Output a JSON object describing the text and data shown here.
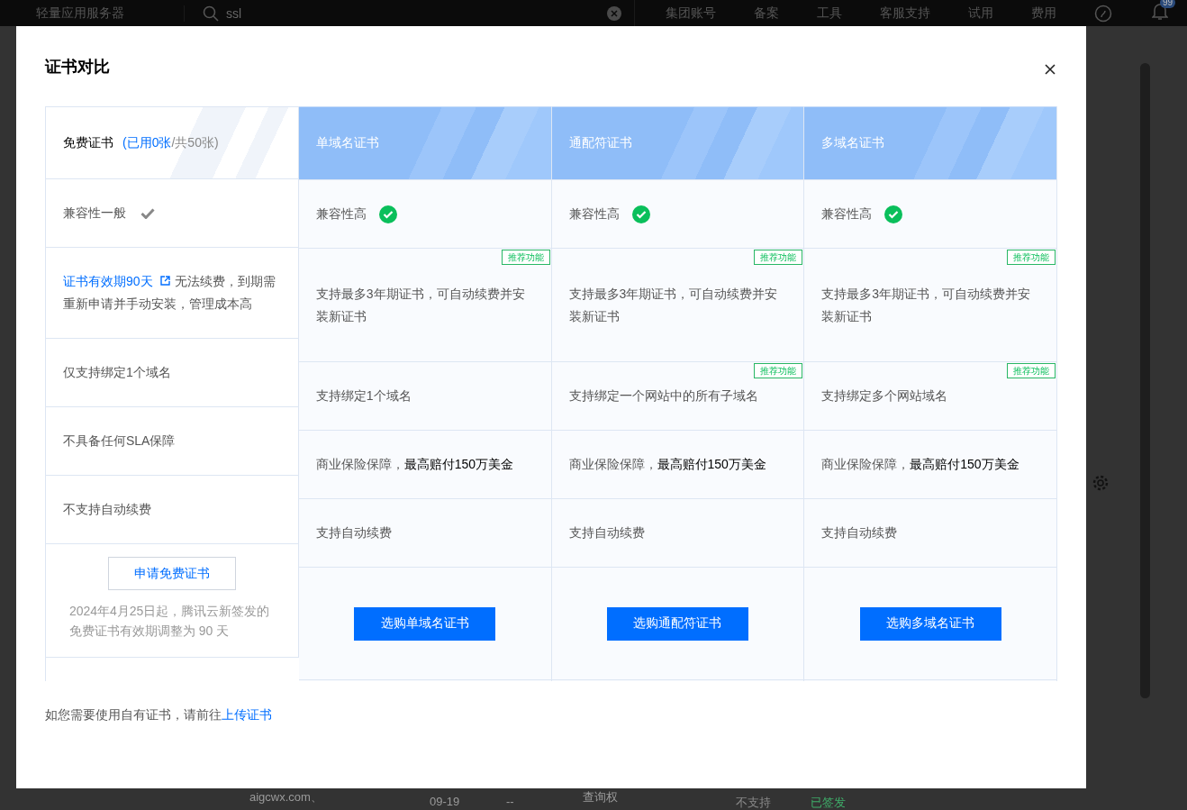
{
  "top_bar": {
    "product": "轻量应用服务器",
    "search": {
      "value": "ssl"
    },
    "nav": [
      "集团账号",
      "备案",
      "工具",
      "客服支持",
      "试用",
      "费用"
    ],
    "badge": "99"
  },
  "background_row": [
    "aigcwx.com、",
    "09-19",
    "--",
    "查询权",
    "不支持",
    "已签发"
  ],
  "dialog": {
    "title": "证书对比",
    "free": {
      "title": "免费证书",
      "used": "(已用0张",
      "total": "/共50张)",
      "rows": [
        {
          "kind": "compat-basic",
          "text": "兼容性一般"
        },
        {
          "kind": "link",
          "link": "证书有效期90天",
          "text": "无法续费，到期需重新申请并手动安装，管理成本高"
        },
        {
          "kind": "plain",
          "text": "仅支持绑定1个域名"
        },
        {
          "kind": "plain",
          "text": "不具备任何SLA保障"
        },
        {
          "kind": "plain",
          "text": "不支持自动续费"
        }
      ],
      "apply_button": "申请免费证书",
      "notice": "2024年4月25日起，腾讯云新签发的免费证书有效期调整为 90 天"
    },
    "plans": [
      {
        "name": "单域名证书",
        "buy_button": "选购单域名证书",
        "rows": [
          {
            "kind": "compat-high",
            "text": "兼容性高"
          },
          {
            "kind": "plain",
            "text": "支持最多3年期证书，可自动续费并安装新证书",
            "tag": "推荐功能"
          },
          {
            "kind": "plain",
            "text": "支持绑定1个域名"
          },
          {
            "kind": "plain",
            "text": "商业保险保障，**最高赔付150万美金**"
          },
          {
            "kind": "plain",
            "text": "支持自动续费"
          }
        ]
      },
      {
        "name": "通配符证书",
        "buy_button": "选购通配符证书",
        "rows": [
          {
            "kind": "compat-high",
            "text": "兼容性高"
          },
          {
            "kind": "plain",
            "text": "支持最多3年期证书，可自动续费并安装新证书",
            "tag": "推荐功能"
          },
          {
            "kind": "plain",
            "text": "支持绑定一个网站中的所有子域名",
            "tag": "推荐功能"
          },
          {
            "kind": "plain",
            "text": "商业保险保障，**最高赔付150万美金**"
          },
          {
            "kind": "plain",
            "text": "支持自动续费"
          }
        ]
      },
      {
        "name": "多域名证书",
        "buy_button": "选购多域名证书",
        "rows": [
          {
            "kind": "compat-high",
            "text": "兼容性高"
          },
          {
            "kind": "plain",
            "text": "支持最多3年期证书，可自动续费并安装新证书",
            "tag": "推荐功能"
          },
          {
            "kind": "plain",
            "text": "支持绑定多个网站域名",
            "tag": "推荐功能"
          },
          {
            "kind": "plain",
            "text": "商业保险保障，**最高赔付150万美金**"
          },
          {
            "kind": "plain",
            "text": "支持自动续费"
          }
        ]
      }
    ],
    "footer": {
      "text": "如您需要使用自有证书，请前往",
      "link": "上传证书"
    }
  }
}
